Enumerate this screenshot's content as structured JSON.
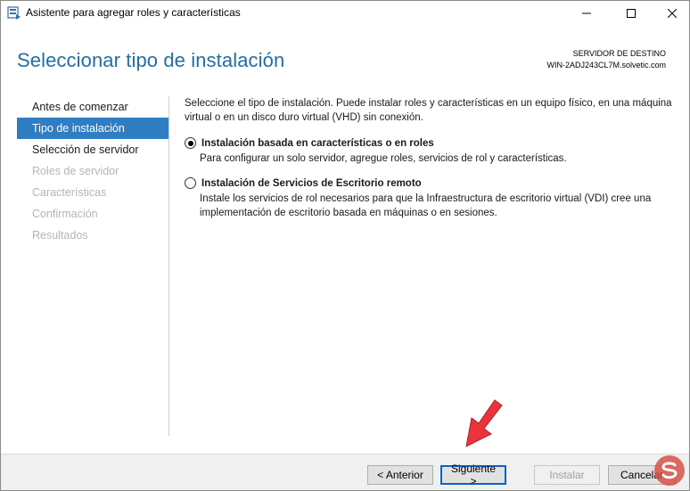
{
  "window": {
    "title": "Asistente para agregar roles y características"
  },
  "header": {
    "page_title": "Seleccionar tipo de instalación",
    "dest_label": "SERVIDOR DE DESTINO",
    "dest_server": "WIN-2ADJ243CL7M.solvetic.com"
  },
  "sidebar": {
    "items": [
      {
        "label": "Antes de comenzar",
        "state": "normal"
      },
      {
        "label": "Tipo de instalación",
        "state": "active"
      },
      {
        "label": "Selección de servidor",
        "state": "normal"
      },
      {
        "label": "Roles de servidor",
        "state": "disabled"
      },
      {
        "label": "Características",
        "state": "disabled"
      },
      {
        "label": "Confirmación",
        "state": "disabled"
      },
      {
        "label": "Resultados",
        "state": "disabled"
      }
    ]
  },
  "content": {
    "intro": "Seleccione el tipo de instalación. Puede instalar roles y características en un equipo físico, en una máquina virtual o en un disco duro virtual (VHD) sin conexión.",
    "options": [
      {
        "title": "Instalación basada en características o en roles",
        "description": "Para configurar un solo servidor, agregue roles, servicios de rol y características.",
        "selected": true
      },
      {
        "title": "Instalación de Servicios de Escritorio remoto",
        "description": "Instale los servicios de rol necesarios para que la Infraestructura de escritorio virtual (VDI) cree una implementación de escritorio basada en máquinas o en sesiones.",
        "selected": false
      }
    ]
  },
  "footer": {
    "prev_label": "< Anterior",
    "next_label": "Siguiente >",
    "install_label": "Instalar",
    "cancel_label": "Cancelar"
  },
  "colors": {
    "accent": "#2f7ec4",
    "title_blue": "#1f6ea8",
    "annotation_arrow": "#e8343a"
  },
  "icons": {
    "app": "server-manager-icon",
    "annotation": "red-arrow-icon",
    "watermark": "solvetic-logo-icon"
  }
}
